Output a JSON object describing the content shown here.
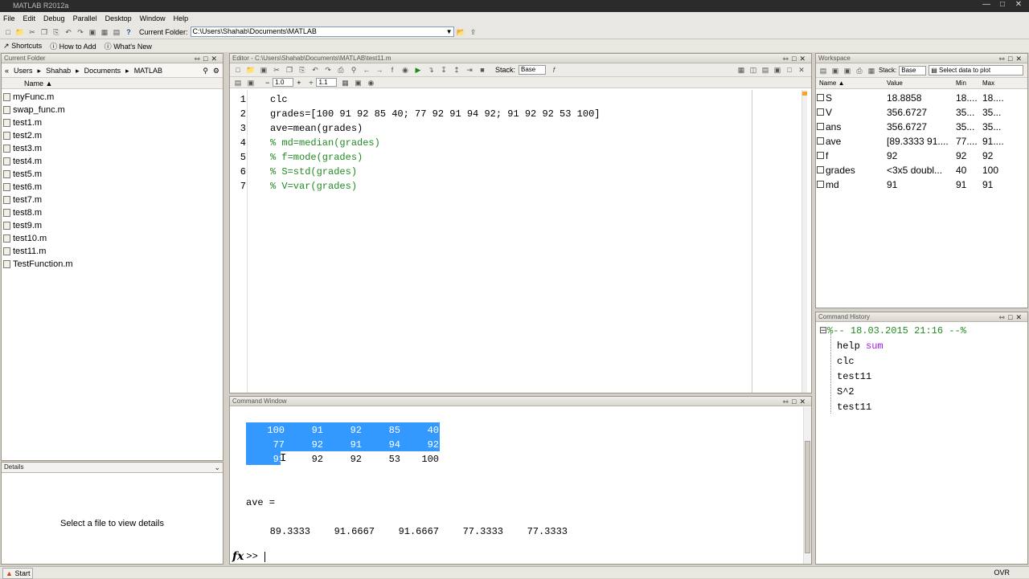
{
  "app": {
    "title": "MATLAB R2012a",
    "start_label": "Start",
    "ovr_label": "OVR"
  },
  "menu": [
    "File",
    "Edit",
    "Debug",
    "Parallel",
    "Desktop",
    "Window",
    "Help"
  ],
  "toolbar": {
    "current_folder_label": "Current Folder:",
    "current_folder_value": "C:\\Users\\Shahab\\Documents\\MATLAB"
  },
  "shortcuts": {
    "shortcuts_label": "Shortcuts",
    "how_to_add": "How to Add",
    "whats_new": "What's New"
  },
  "current_folder": {
    "title": "Current Folder",
    "breadcrumb": [
      "Users",
      "Shahab",
      "Documents",
      "MATLAB"
    ],
    "name_header": "Name",
    "files": [
      "myFunc.m",
      "swap_func.m",
      "test1.m",
      "test2.m",
      "test3.m",
      "test4.m",
      "test5.m",
      "test6.m",
      "test7.m",
      "test8.m",
      "test9.m",
      "test10.m",
      "test11.m",
      "TestFunction.m"
    ]
  },
  "details": {
    "title": "Details",
    "empty_text": "Select a file to view details"
  },
  "editor": {
    "title": "Editor - C:\\Users\\Shahab\\Documents\\MATLAB\\test11.m",
    "cell_minus": "−",
    "cell_value1": "1.0",
    "cell_plus": "+",
    "cell_div": "÷",
    "cell_value2": "1.1",
    "stack_label": "Stack:",
    "stack_value": "Base",
    "lines": [
      {
        "n": "1",
        "text": "clc",
        "comment": false
      },
      {
        "n": "2",
        "text": "grades=[100 91 92 85 40; 77 92 91 94 92; 91 92 92 53 100]",
        "comment": false
      },
      {
        "n": "3",
        "text": "ave=mean(grades)",
        "comment": false
      },
      {
        "n": "4",
        "text": "% md=median(grades)",
        "comment": true
      },
      {
        "n": "5",
        "text": "% f=mode(grades)",
        "comment": true
      },
      {
        "n": "6",
        "text": "% S=std(grades)",
        "comment": true
      },
      {
        "n": "7",
        "text": "% V=var(grades)",
        "comment": true
      }
    ]
  },
  "command_window": {
    "title": "Command Window",
    "matrix_rows": [
      [
        "100",
        "91",
        "92",
        "85",
        "40"
      ],
      [
        "77",
        "92",
        "91",
        "94",
        "92"
      ],
      [
        "91",
        "92",
        "92",
        "53",
        "100"
      ]
    ],
    "ave_label": "ave =",
    "ave_values": [
      "89.3333",
      "91.6667",
      "91.6667",
      "77.3333",
      "77.3333"
    ],
    "fx": "fx",
    "prompt": ">>"
  },
  "workspace": {
    "title": "Workspace",
    "stack_label": "Stack:",
    "stack_value": "Base",
    "plot_label": "Select data to plot",
    "headers": [
      "Name",
      "Value",
      "Min",
      "Max"
    ],
    "vars": [
      {
        "name": "S",
        "value": "18.8858",
        "min": "18....",
        "max": "18...."
      },
      {
        "name": "V",
        "value": "356.6727",
        "min": "35...",
        "max": "35..."
      },
      {
        "name": "ans",
        "value": "356.6727",
        "min": "35...",
        "max": "35..."
      },
      {
        "name": "ave",
        "value": "[89.3333 91....",
        "min": "77....",
        "max": "91...."
      },
      {
        "name": "f",
        "value": "92",
        "min": "92",
        "max": "92"
      },
      {
        "name": "grades",
        "value": "<3x5 doubl...",
        "min": "40",
        "max": "100"
      },
      {
        "name": "md",
        "value": "91",
        "min": "91",
        "max": "91"
      }
    ]
  },
  "history": {
    "title": "Command History",
    "session": "%-- 18.03.2015 21:16 --%",
    "cmd_help": "help",
    "cmd_help_arg": "sum",
    "items": [
      "clc",
      "test11",
      "S^2",
      "test11"
    ]
  }
}
